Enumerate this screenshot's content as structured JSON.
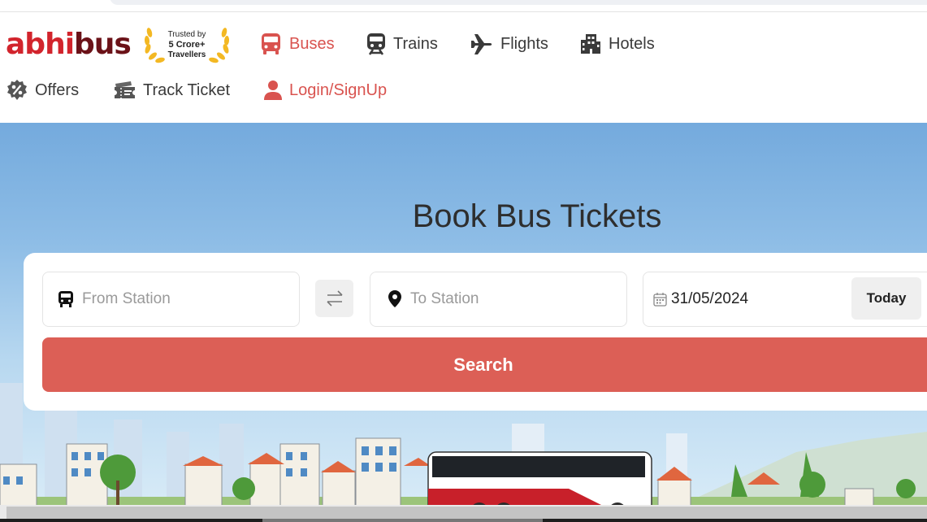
{
  "brand": {
    "name_part1": "abhi",
    "name_part2": "bus"
  },
  "trusted_badge": {
    "line1": "Trusted by",
    "line2": "5 Crore+",
    "line3": "Travellers"
  },
  "nav": {
    "buses": "Buses",
    "trains": "Trains",
    "flights": "Flights",
    "hotels": "Hotels",
    "offers": "Offers",
    "track_ticket": "Track Ticket",
    "login": "Login/SignUp"
  },
  "hero": {
    "title": "Book Bus Tickets"
  },
  "search_form": {
    "from_placeholder": "From Station",
    "to_placeholder": "To Station",
    "date_value": "31/05/2024",
    "today_label": "Today",
    "search_label": "Search"
  },
  "colors": {
    "brand_red": "#d2242c",
    "accent_red": "#d9534f",
    "search_button": "#dc5f56",
    "sky": "#74aadd"
  },
  "icons": [
    "bus-icon",
    "train-icon",
    "plane-icon",
    "hotel-icon",
    "offers-percent-icon",
    "ticket-icon",
    "user-icon",
    "swap-icon",
    "location-pin-icon",
    "calendar-icon",
    "laurel-wreath-icon"
  ]
}
